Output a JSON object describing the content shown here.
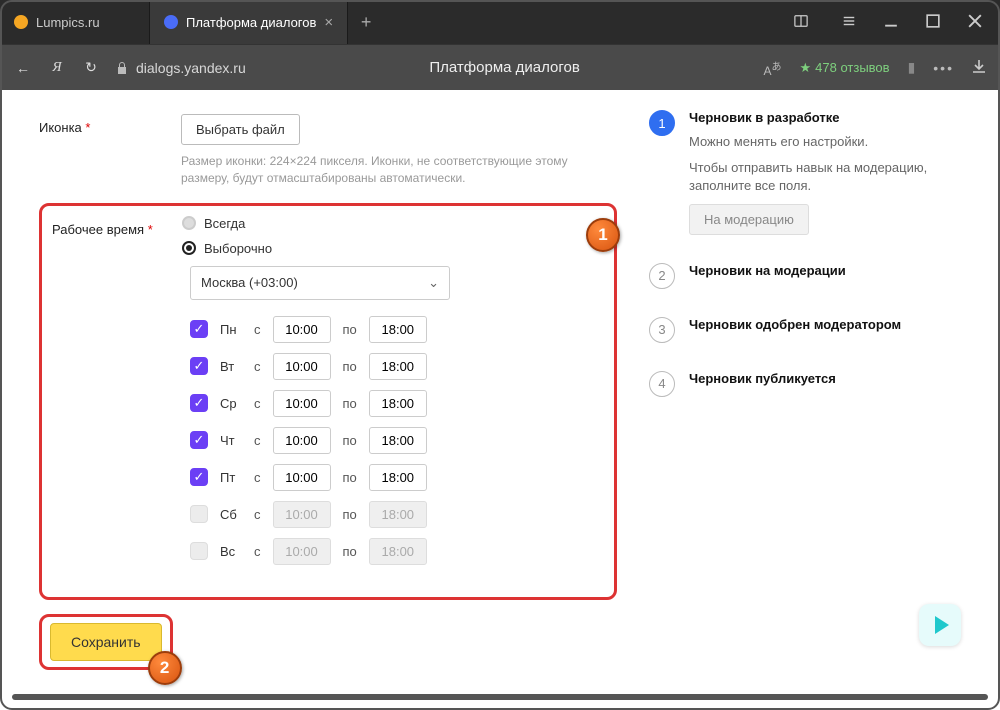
{
  "titlebar": {
    "tabs": [
      {
        "title": "Lumpics.ru",
        "favicon_color": "#f5a623",
        "active": false
      },
      {
        "title": "Платформа диалогов",
        "favicon_color": "#4a6cf7",
        "active": true
      }
    ]
  },
  "addrbar": {
    "url": "dialogs.yandex.ru",
    "page_title": "Платформа диалогов",
    "rating": "478 отзывов"
  },
  "form": {
    "icon_row": {
      "label": "Иконка",
      "button": "Выбрать файл",
      "hint": "Размер иконки: 224×224 пикселя. Иконки, не соответствующие этому размеру, будут отмасштабированы автоматически."
    },
    "hours": {
      "label": "Рабочее время",
      "options": {
        "always": "Всегда",
        "custom": "Выборочно"
      },
      "selected": "custom",
      "timezone": "Москва (+03:00)",
      "from_label": "с",
      "to_label": "по",
      "days": [
        {
          "name": "Пн",
          "checked": true,
          "from": "10:00",
          "to": "18:00"
        },
        {
          "name": "Вт",
          "checked": true,
          "from": "10:00",
          "to": "18:00"
        },
        {
          "name": "Ср",
          "checked": true,
          "from": "10:00",
          "to": "18:00"
        },
        {
          "name": "Чт",
          "checked": true,
          "from": "10:00",
          "to": "18:00"
        },
        {
          "name": "Пт",
          "checked": true,
          "from": "10:00",
          "to": "18:00"
        },
        {
          "name": "Сб",
          "checked": false,
          "from": "10:00",
          "to": "18:00"
        },
        {
          "name": "Вс",
          "checked": false,
          "from": "10:00",
          "to": "18:00"
        }
      ]
    },
    "save": "Сохранить"
  },
  "steps": [
    {
      "num": "1",
      "active": true,
      "title": "Черновик в разработке",
      "desc1": "Можно менять его настройки.",
      "desc2": "Чтобы отправить навык на модерацию, заполните все поля.",
      "button": "На модерацию"
    },
    {
      "num": "2",
      "active": false,
      "title": "Черновик на модерации"
    },
    {
      "num": "3",
      "active": false,
      "title": "Черновик одобрен модератором"
    },
    {
      "num": "4",
      "active": false,
      "title": "Черновик публикуется"
    }
  ],
  "annotations": {
    "one": "1",
    "two": "2"
  }
}
